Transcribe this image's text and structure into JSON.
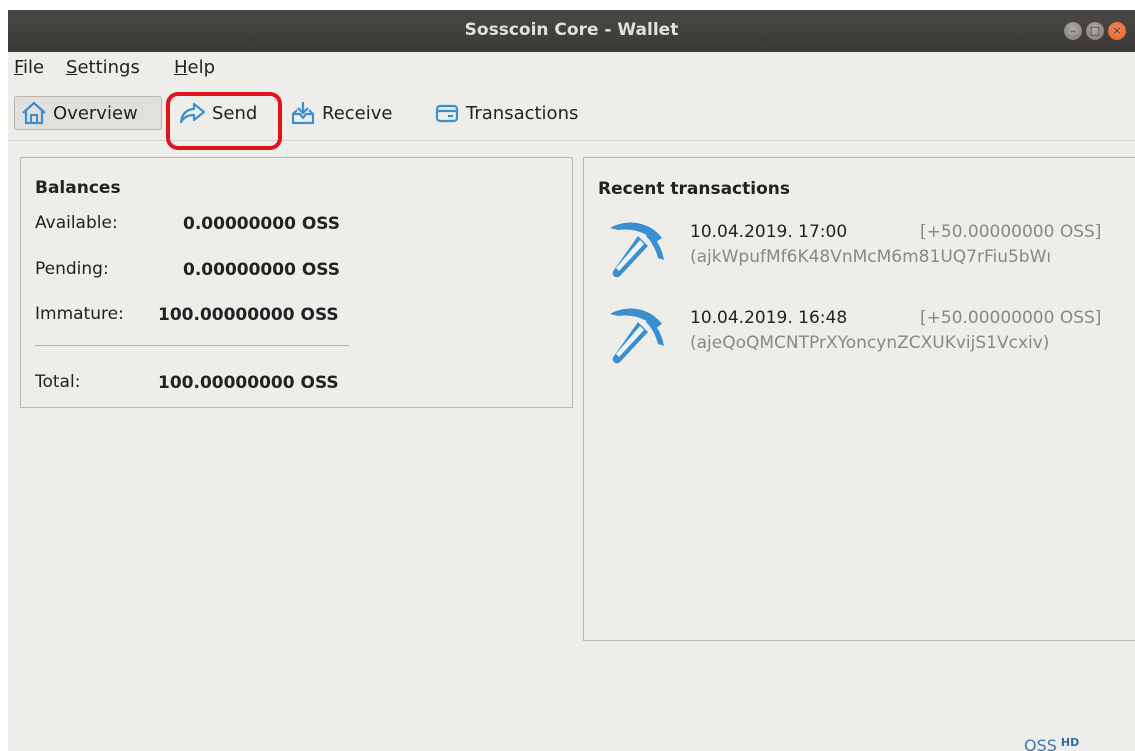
{
  "window": {
    "title": "Sosscoin Core - Wallet"
  },
  "menu": {
    "file": "File",
    "settings": "Settings",
    "help": "Help"
  },
  "toolbar": {
    "overview": "Overview",
    "send": "Send",
    "receive": "Receive",
    "transactions": "Transactions"
  },
  "balances": {
    "heading": "Balances",
    "available_label": "Available:",
    "available_value": "0.00000000 OSS",
    "pending_label": "Pending:",
    "pending_value": "0.00000000 OSS",
    "immature_label": "Immature:",
    "immature_value": "100.00000000 OSS",
    "total_label": "Total:",
    "total_value": "100.00000000 OSS"
  },
  "recent": {
    "heading": "Recent transactions",
    "items": [
      {
        "date": "10.04.2019. 17:00",
        "amount": "[+50.00000000 OSS]",
        "address": "(ajkWpufMf6K48VnMcM6m81UQ7rFiu5bWı",
        "icon": "pickaxe-icon"
      },
      {
        "date": "10.04.2019. 16:48",
        "amount": "[+50.00000000 OSS]",
        "address": "(ajeQoQMCNTPrXYoncynZCXUKvijS1Vcxiv)",
        "icon": "pickaxe-icon"
      }
    ]
  },
  "status": {
    "unit": "OSS",
    "hd": "HD"
  },
  "colors": {
    "accent": "#3a8fd0",
    "highlight": "#e0141e"
  }
}
